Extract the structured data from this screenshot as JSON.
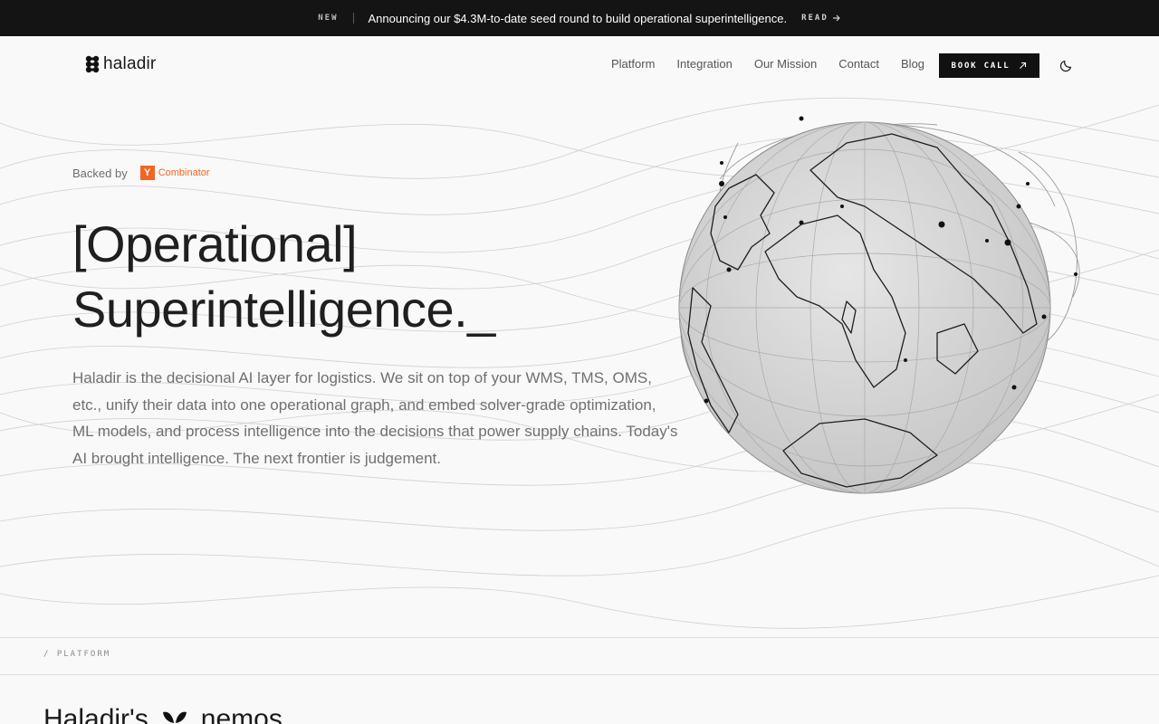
{
  "announcement": {
    "tag": "NEW",
    "message": "Announcing our $4.3M-to-date seed round to build operational superintelligence.",
    "cta": "READ"
  },
  "nav": {
    "brand": "haladir",
    "links": [
      "Platform",
      "Integration",
      "Our Mission",
      "Contact",
      "Blog"
    ],
    "book_call": "BOOK CALL"
  },
  "hero": {
    "backed_by": "Backed by",
    "backer_logo_letter": "Y",
    "backer_name": "Combinator",
    "title_line1": "[Operational]",
    "title_line2": "Superintelligence._",
    "description": "Haladir is the decisional AI layer for logistics. We sit on top of your WMS, TMS, OMS, etc., unify their data into one operational graph, and embed solver-grade optimization, ML models, and process intelligence into the decisions that power supply chains. Today's AI brought intelligence. The next frontier is judgement."
  },
  "platform_section": {
    "breadcrumb": "/  PLATFORM",
    "title_start": "Haladir's",
    "title_end": "nemos"
  },
  "colors": {
    "accent_yc": "#f26522",
    "dark": "#141414",
    "background": "#f9f9f9"
  },
  "icons": {
    "read": "arrow-right-icon",
    "book_call": "arrow-up-right-icon",
    "theme": "moon-icon",
    "brand": "haladir-logo-icon"
  }
}
